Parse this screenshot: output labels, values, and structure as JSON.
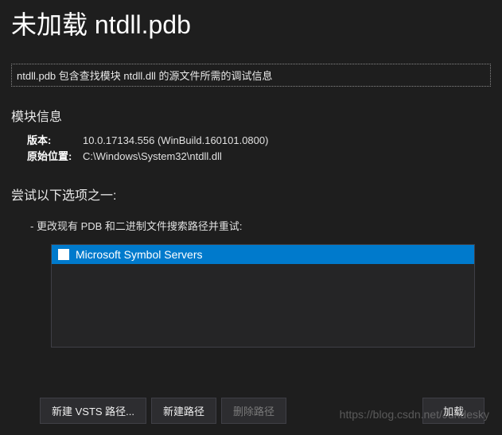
{
  "title": "未加载 ntdll.pdb",
  "infoBanner": "ntdll.pdb 包含查找模块 ntdll.dll 的源文件所需的调试信息",
  "module": {
    "heading": "模块信息",
    "versionLabel": "版本:",
    "versionValue": "10.0.17134.556 (WinBuild.160101.0800)",
    "pathLabel": "原始位置:",
    "pathValue": "C:\\Windows\\System32\\ntdll.dll"
  },
  "options": {
    "heading": "尝试以下选项之一:",
    "bullet": "更改现有 PDB 和二进制文件搜索路径并重试:",
    "listItem": "Microsoft Symbol Servers"
  },
  "buttons": {
    "newVsts": "新建 VSTS 路径...",
    "newPath": "新建路径",
    "deletePath": "删除路径",
    "load": "加载"
  },
  "watermark": "https://blog.csdn.net/Jundesky"
}
